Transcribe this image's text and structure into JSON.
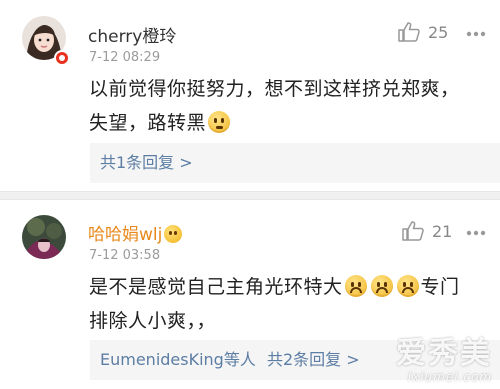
{
  "comments": [
    {
      "username": "cherry橙玲",
      "time": "7-12 08:29",
      "likes": "25",
      "content_line1": "以前觉得你挺努力，想不到这样挤兑郑爽，",
      "content_line2": "失望，路转黑",
      "replies_prefix": "",
      "replies_label": "共1条回复 >",
      "emoji": "thinking-emoji"
    },
    {
      "username": "哈哈娟wlj",
      "time": "7-12 03:58",
      "likes": "21",
      "content_line1": "是不是感觉自己主角光环特大",
      "content_line1_tail": "专门",
      "content_line2": "排除人小爽，，",
      "replies_prefix": "EumenidesKing等人",
      "replies_label": "共2条回复 >",
      "emoji": "crying-emoji"
    }
  ],
  "watermark": {
    "main": "爱秀美",
    "sub": "ixiumei.com"
  },
  "colors": {
    "link": "#5c7da4",
    "gold_name": "#e8891b",
    "badge": "#e8321f",
    "reply_bg": "#f5f5f5"
  }
}
